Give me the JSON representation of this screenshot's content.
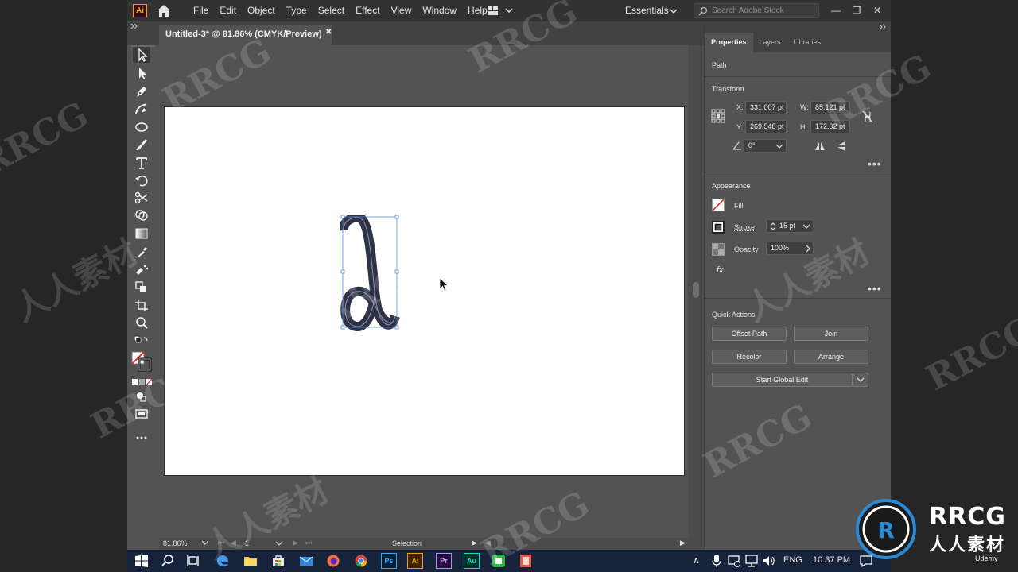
{
  "app": {
    "logo": "Ai",
    "menu": [
      "File",
      "Edit",
      "Object",
      "Type",
      "Select",
      "Effect",
      "View",
      "Window",
      "Help"
    ],
    "workspace": "Essentials",
    "search_placeholder": "Search Adobe Stock",
    "window_controls": [
      "—",
      "❐",
      "✕"
    ]
  },
  "document": {
    "tab_title": "Untitled-3* @ 81.86% (CMYK/Preview)",
    "close_glyph": "✖"
  },
  "status": {
    "zoom": "81.86%",
    "artboard_number": "1",
    "tool_name": "Selection"
  },
  "panel": {
    "tabs": [
      "Properties",
      "Layers",
      "Libraries"
    ],
    "object_type": "Path",
    "transform": {
      "title": "Transform",
      "x_label": "X:",
      "x_value": "331.007 pt",
      "y_label": "Y:",
      "y_value": "269.548 pt",
      "w_label": "W:",
      "w_value": "85.121 pt",
      "h_label": "H:",
      "h_value": "172.02 pt",
      "angle_value": "0°"
    },
    "appearance": {
      "title": "Appearance",
      "fill_label": "Fill",
      "stroke_label": "Stroke",
      "stroke_value": "15 pt",
      "opacity_label": "Opacity",
      "opacity_value": "100%",
      "fx_label": "fx."
    },
    "quick_actions": {
      "title": "Quick Actions",
      "offset_path": "Offset Path",
      "join": "Join",
      "recolor": "Recolor",
      "arrange": "Arrange",
      "start_global_edit": "Start Global Edit"
    }
  },
  "taskbar": {
    "apps": [
      "Ps",
      "Ai",
      "Pr",
      "Au"
    ],
    "language": "ENG",
    "time": "10:37 PM"
  },
  "watermark": {
    "latin": "RRCG",
    "cn": "人人素材",
    "brand_latin": "RRCG",
    "brand_cn": "人人素材",
    "udemy": "Udemy"
  },
  "colors": {
    "ui_bg": "#535353",
    "menubar_bg": "#323232",
    "artboard": "#ffffff",
    "stroke_shape": "#2f3346",
    "selection_blue": "#5b8bd6",
    "taskbar": "#17233a",
    "ai_orange": "#ff9a00"
  }
}
